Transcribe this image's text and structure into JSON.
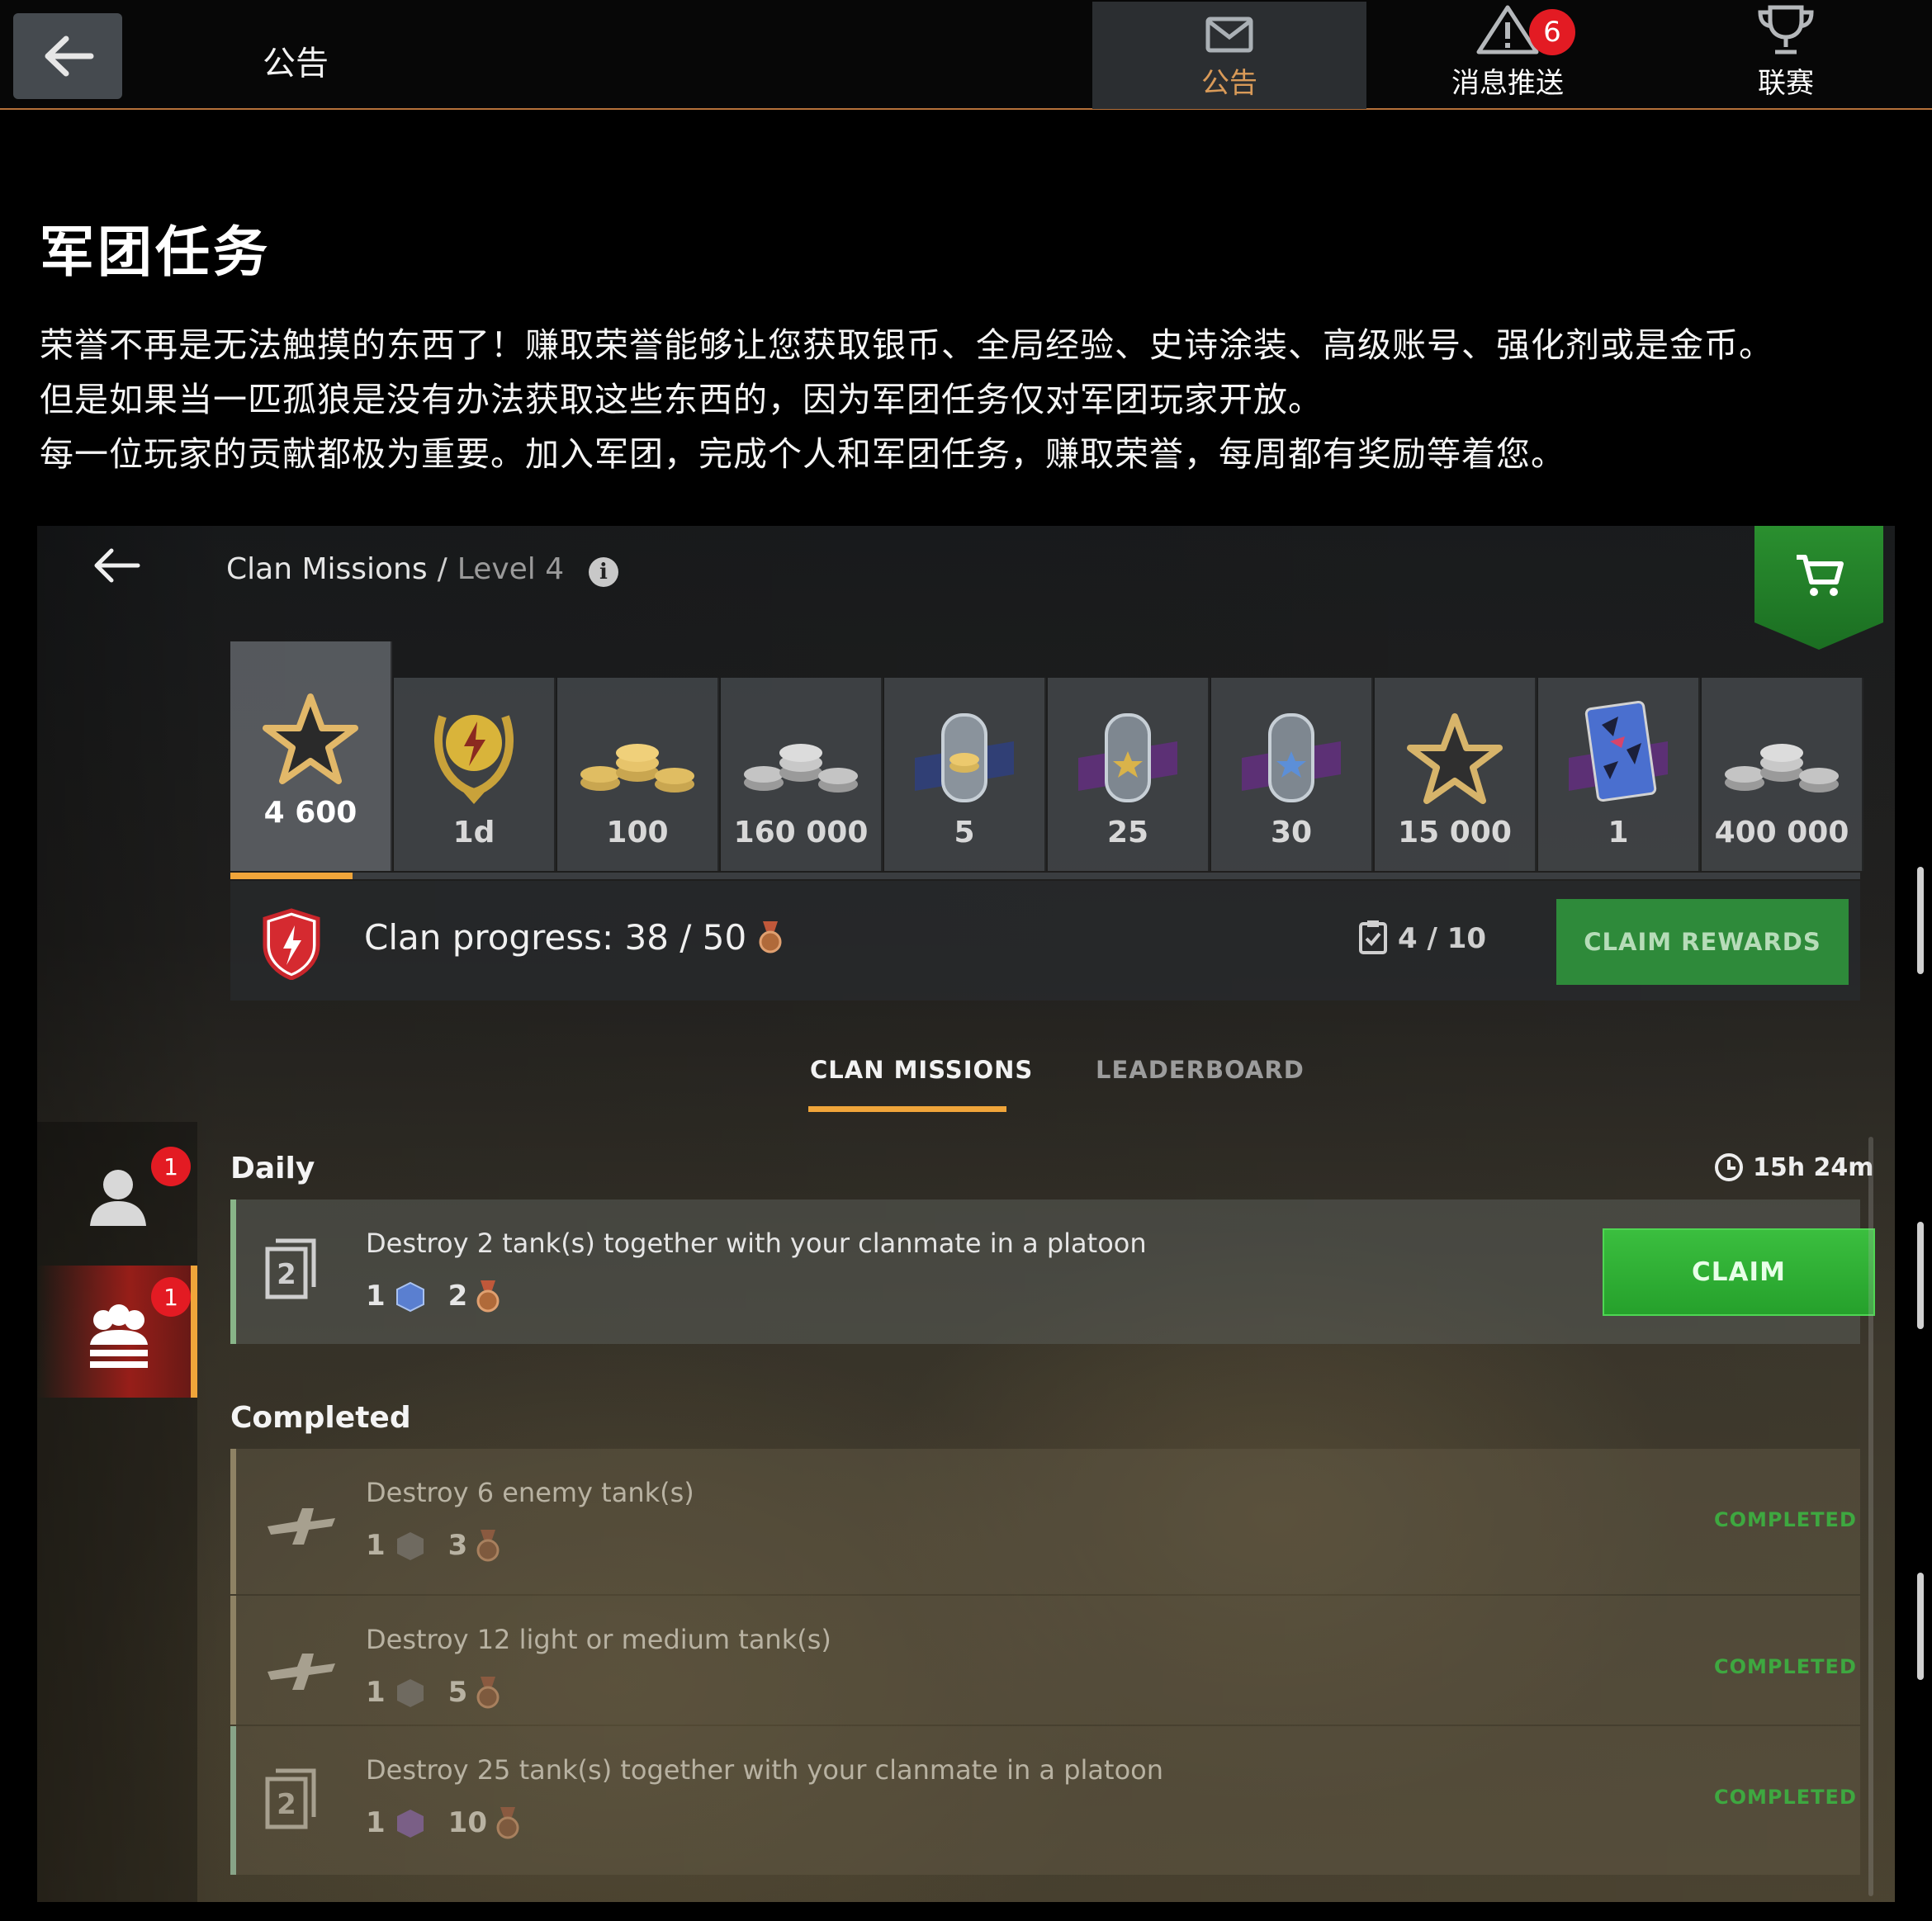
{
  "topbar": {
    "title": "公告",
    "tabs": [
      {
        "label": "公告",
        "icon": "mail-icon",
        "active": true
      },
      {
        "label": "消息推送",
        "icon": "warning-icon",
        "badge": "6"
      },
      {
        "label": "联赛",
        "icon": "trophy-icon"
      }
    ]
  },
  "article": {
    "headline": "军团任务",
    "paragraphs": [
      "荣誉不再是无法触摸的东西了！赚取荣誉能够让您获取银币、全局经验、史诗涂装、高级账号、强化剂或是金币。",
      "但是如果当一匹孤狼是没有办法获取这些东西的，因为军团任务仅对军团玩家开放。",
      "每一位玩家的贡献都极为重要。加入军团，完成个人和军团任务，赚取荣誉，每周都有奖励等着您。"
    ]
  },
  "game": {
    "breadcrumb": {
      "section": "Clan Missions",
      "separator": "/",
      "level": "Level 4"
    },
    "rewards": [
      {
        "value": "4 600",
        "icon": "star-icon"
      },
      {
        "value": "1d",
        "icon": "premium-laurel-icon"
      },
      {
        "value": "100",
        "icon": "gold-coins-icon"
      },
      {
        "value": "160 000",
        "icon": "silver-coins-icon"
      },
      {
        "value": "5",
        "icon": "gold-tag-icon"
      },
      {
        "value": "25",
        "icon": "star-tag-icon"
      },
      {
        "value": "30",
        "icon": "blue-star-tag-icon"
      },
      {
        "value": "15 000",
        "icon": "star-outline-icon"
      },
      {
        "value": "1",
        "icon": "camo-card-icon"
      },
      {
        "value": "400 000",
        "icon": "silver-coins-icon"
      }
    ],
    "reward_progress": 0.075,
    "clan_progress_label": "Clan progress: 38 / 50",
    "tasks_count": "4 / 10",
    "claim_rewards_label": "CLAIM REWARDS",
    "tabs": {
      "missions": "CLAN MISSIONS",
      "leaderboard": "LEADERBOARD"
    },
    "side_badges": {
      "personal": "1",
      "clan": "1"
    },
    "daily": {
      "title": "Daily",
      "timer": "15h 24m",
      "mission": {
        "text": "Destroy 2 tank(s) together with your clanmate in a platoon",
        "reward1": "1",
        "reward2": "2",
        "claim_label": "CLAIM"
      }
    },
    "completed": {
      "title": "Completed",
      "items": [
        {
          "text": "Destroy 6 enemy tank(s)",
          "reward1": "1",
          "reward2": "3",
          "status": "COMPLETED"
        },
        {
          "text": "Destroy 12 light or medium tank(s)",
          "reward1": "1",
          "reward2": "5",
          "status": "COMPLETED"
        },
        {
          "text": "Destroy 25 tank(s) together with your clanmate in a platoon",
          "reward1": "1",
          "reward2": "10",
          "status": "COMPLETED"
        }
      ]
    }
  }
}
